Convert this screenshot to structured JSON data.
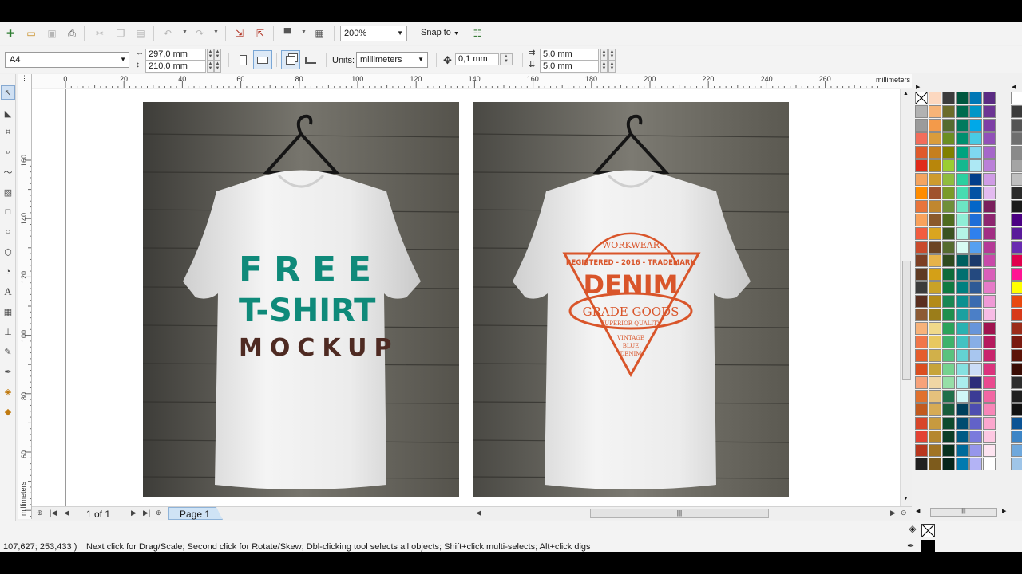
{
  "toolbar": {
    "zoom": "200%",
    "snap_label": "Snap to"
  },
  "propertybar": {
    "page_size": "A4",
    "width": "297,0 mm",
    "height": "210,0 mm",
    "units_label": "Units:",
    "units_value": "millimeters",
    "nudge": "0,1 mm",
    "dup_x": "5,0 mm",
    "dup_y": "5,0 mm"
  },
  "ruler": {
    "unit_label": "millimeters",
    "h_ticks": [
      "0",
      "20",
      "40",
      "60",
      "80",
      "100",
      "120",
      "140",
      "160",
      "180",
      "200",
      "220",
      "240",
      "260"
    ],
    "v_ticks": [
      "160",
      "140",
      "120",
      "100",
      "80",
      "60"
    ],
    "v_unit_label": "millimeters"
  },
  "shirt_left": {
    "line1": "FREE",
    "line2": "T-SHIRT",
    "line3": "MOCKUP",
    "teal_color": "#0f8a7a",
    "brown_color": "#4e2a22"
  },
  "shirt_right": {
    "top": "WORKWEAR",
    "registered": "REGISTERED - 2016 - TRADEMARK",
    "main": "DENIM",
    "grade": "GRADE GOODS",
    "quality": "SUPERIOR QUALITY",
    "vintage": "VINTAGE",
    "blue": "BLUE",
    "denim_small": "DENIM",
    "ink_color": "#d9552a"
  },
  "pagenav": {
    "count": "1 of 1",
    "tab": "Page 1"
  },
  "status": {
    "coords": "107,627; 253,433 )",
    "hint": "Next click for Drag/Scale; Second click for Rotate/Skew; Dbl-clicking tool selects all objects; Shift+click multi-selects; Alt+click digs"
  },
  "palette": {
    "columns": [
      [
        "#ffffff",
        "#b2b2b2",
        "#9b9b9b",
        "#f26d5b",
        "#e05a2b",
        "#e02a1a",
        "#f4a460",
        "#ff8c00",
        "#e8743b",
        "#f9a25c",
        "#f25c3f",
        "#c94a2c",
        "#7c3f24",
        "#5e3a22",
        "#3b3b3b",
        "#5a2e1e",
        "#8c5a34",
        "#f7b27a",
        "#f0764a",
        "#e55d2c",
        "#db4e1f",
        "#f6a27a",
        "#e0712e",
        "#c25a1f",
        "#d8462a",
        "#e34234",
        "#b8361e",
        "#202020"
      ],
      [
        "#fcd8c0",
        "#f6b478",
        "#f39a4a",
        "#d99c3b",
        "#c57f1f",
        "#b8860b",
        "#cd9b2e",
        "#a0522d",
        "#c0872f",
        "#8b5a2b",
        "#daa520",
        "#6b4423",
        "#e6b34a",
        "#d4a017",
        "#c9a227",
        "#b38b18",
        "#9b7d1a",
        "#f0d98a",
        "#e8c860",
        "#d1b04a",
        "#c6a43a",
        "#efd6a4",
        "#e5c17c",
        "#d6ab55",
        "#c79a3f",
        "#b5872e",
        "#a17424",
        "#7d5b1c"
      ],
      [
        "#3c3c3c",
        "#6b6b2a",
        "#556b2f",
        "#6b8e23",
        "#808000",
        "#9acd32",
        "#8fbc3f",
        "#7a9a2a",
        "#6f8f3a",
        "#4f6b1f",
        "#3b5321",
        "#556b2f",
        "#2e4a1f",
        "#0e6b3a",
        "#0f7a41",
        "#198754",
        "#1e8f4e",
        "#2ca35a",
        "#3fb26b",
        "#5ac27e",
        "#76d28f",
        "#96dfa7",
        "#1f6f4a",
        "#185c3b",
        "#0d4a2e",
        "#0a3d26",
        "#07301e",
        "#05241a"
      ],
      [
        "#00573f",
        "#006a4e",
        "#007a5e",
        "#008f6f",
        "#00a37f",
        "#14b88f",
        "#2ccfa0",
        "#48dbb1",
        "#6ce5c4",
        "#90eed6",
        "#b4f5e6",
        "#d8fbf3",
        "#005f5f",
        "#007070",
        "#008080",
        "#0b9090",
        "#1aa0a0",
        "#2ab1b1",
        "#42c2c2",
        "#63d2d2",
        "#86e0e0",
        "#aaeded",
        "#cff7f7",
        "#003f5c",
        "#004c70",
        "#005b85",
        "#006a9a",
        "#007ab0"
      ],
      [
        "#0077b6",
        "#0096c7",
        "#00a8e8",
        "#48cae4",
        "#7fd8f0",
        "#ade8f4",
        "#023e8a",
        "#0353a4",
        "#0466c8",
        "#1e6ed8",
        "#2f80ed",
        "#56a0f0",
        "#1b3a6b",
        "#24497f",
        "#2e5a96",
        "#3a6bb0",
        "#4b7fc7",
        "#6795da",
        "#87aee6",
        "#a8c6ef",
        "#cbdcf6",
        "#2c2c7a",
        "#3b3b95",
        "#4d4db0",
        "#6262c8",
        "#7a7adc",
        "#9696eb",
        "#b3b3f5"
      ],
      [
        "#5b2c83",
        "#6c3594",
        "#7e3fa6",
        "#9150b8",
        "#a566c9",
        "#ba80d8",
        "#cf9ce5",
        "#e3bbf0",
        "#7a1f5c",
        "#8e2670",
        "#a22e84",
        "#b53a97",
        "#c84aa9",
        "#d95fb9",
        "#e67bc8",
        "#f09ad6",
        "#f7bce5",
        "#a0144f",
        "#b51b5e",
        "#c9246d",
        "#db337d",
        "#ea4a8f",
        "#f266a3",
        "#f886b8",
        "#fba7ce",
        "#fdc8e2",
        "#fde4f0",
        "#ffffff"
      ],
      [
        "#ffffff",
        "#3a3a3a",
        "#555555",
        "#6f6f6f",
        "#8a8a8a",
        "#a4a4a4",
        "#bfbfbf",
        "#2a2a2a",
        "#1a1a1a",
        "#4b0082",
        "#5a1a9a",
        "#6a2bb0",
        "#e0004d",
        "#ff1493",
        "#ffff00",
        "#e8490f",
        "#d73a1a",
        "#9b2c1a",
        "#7a1a10",
        "#5c1408",
        "#3a0c04",
        "#2d2d2d",
        "#1f1f1f",
        "#111111",
        "#0b5394",
        "#3d85c6",
        "#6fa8dc",
        "#9fc5e8"
      ]
    ]
  }
}
